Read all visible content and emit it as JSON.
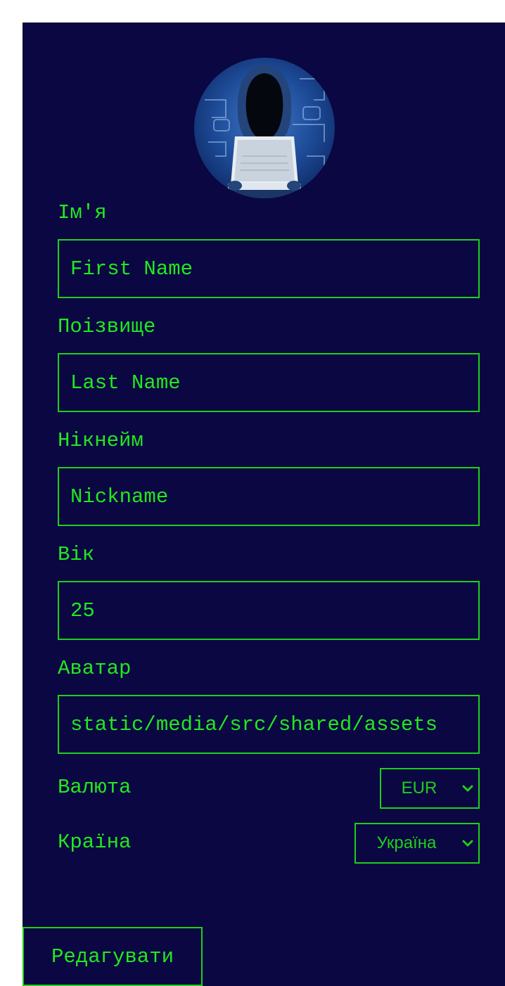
{
  "avatar": {
    "icon": "hacker-avatar-icon"
  },
  "form": {
    "first_name": {
      "label": "Ім'я",
      "placeholder": "First Name",
      "value": ""
    },
    "last_name": {
      "label": "Поізвище",
      "placeholder": "Last Name",
      "value": ""
    },
    "nickname": {
      "label": "Нікнейм",
      "placeholder": "Nickname",
      "value": ""
    },
    "age": {
      "label": "Вік",
      "value": "25"
    },
    "avatar_url": {
      "label": "Аватар",
      "value": "static/media/src/shared/assets"
    },
    "currency": {
      "label": "Валюта",
      "selected": "EUR"
    },
    "country": {
      "label": "Країна",
      "selected": "Україна"
    }
  },
  "actions": {
    "edit_label": "Редагувати"
  },
  "colors": {
    "background": "#0a0743",
    "accent": "#22e81e",
    "border": "#1fcf1a"
  }
}
